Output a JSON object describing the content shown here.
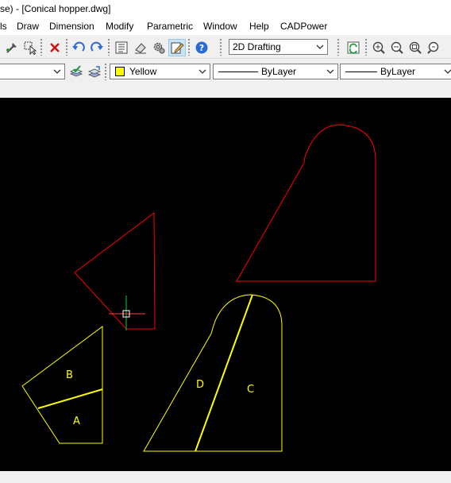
{
  "window": {
    "title": "se) - [Conical hopper.dwg]"
  },
  "menu": {
    "items": [
      "ls",
      "Draw",
      "Dimension",
      "Modify",
      "Parametric",
      "Window",
      "Help",
      "CADPower"
    ]
  },
  "toolbar": {
    "workspace_value": "2D Drafting"
  },
  "properties": {
    "layer_value": "",
    "color_value": "Yellow",
    "color_swatch": "#ffff00",
    "linetype_value": "ByLayer",
    "lineweight_value": "ByLayer"
  },
  "drawing": {
    "background": "#000000",
    "colors": {
      "red": "#ff0000",
      "yellow": "#ffff00",
      "crosshair_green": "#00ff00",
      "crosshair_red": "#ff4040"
    },
    "labels": {
      "a": "A",
      "b": "B",
      "c": "C",
      "d": "D"
    }
  },
  "icons": [
    "pick-point-icon",
    "select-objects-icon",
    "delete-icon",
    "undo-icon",
    "redo-icon",
    "properties-icon",
    "eraser-icon",
    "settings-gear-icon",
    "edit-icon",
    "help-icon",
    "workspace-refresh-icon",
    "zoom-in-icon",
    "zoom-out-icon",
    "zoom-window-icon",
    "zoom-extents-icon",
    "layer-make-current-icon",
    "layer-previous-icon"
  ]
}
